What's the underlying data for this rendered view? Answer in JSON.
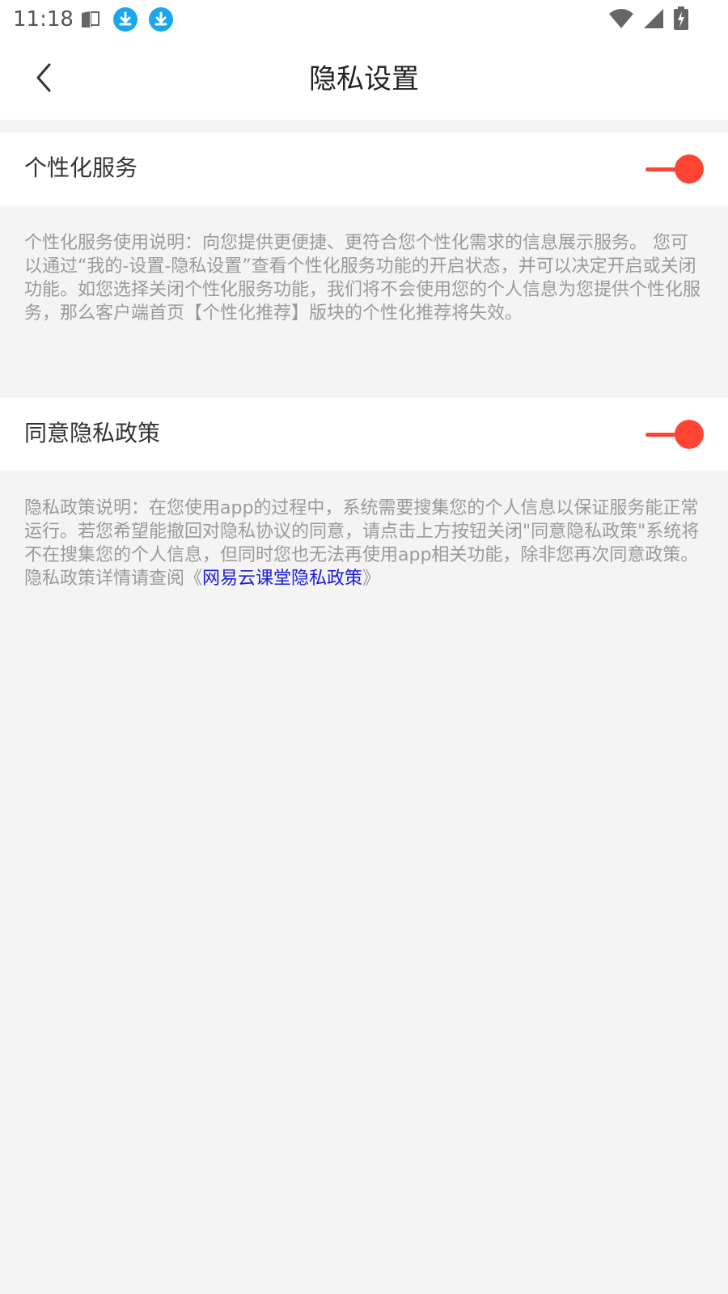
{
  "status_bar": {
    "time": "11:18",
    "left_icons": [
      "notification-icon",
      "download-icon",
      "download-icon"
    ],
    "right_icons": [
      "wifi-icon",
      "signal-icon",
      "battery-charging-icon"
    ],
    "accent": "#1aa7f0"
  },
  "header": {
    "title": "隐私设置",
    "back_icon": "chevron-left-icon"
  },
  "settings": [
    {
      "label": "个性化服务",
      "enabled": true,
      "description": "个性化服务使用说明：向您提供更便捷、更符合您个性化需求的信息展示服务。 您可以通过“我的-设置-隐私设置”查看个性化服务功能的开启状态，并可以决定开启或关闭功能。如您选择关闭个性化服务功能，我们将不会使用您的个人信息为您提供个性化服务，那么客户端首页【个性化推荐】版块的个性化推荐将失效。"
    },
    {
      "label": "同意隐私政策",
      "enabled": true,
      "description": "隐私政策说明：在您使用app的过程中，系统需要搜集您的个人信息以保证服务能正常运行。若您希望能撤回对隐私协议的同意，请点击上方按钮关闭\"同意隐私政策\"系统将不在搜集您的个人信息，但同时您也无法再使用app相关功能，除非您再次同意政策。",
      "link_prefix": "隐私政策详情请查阅《",
      "link_text": "网易云课堂隐私政策",
      "link_suffix": "》"
    }
  ],
  "colors": {
    "toggle_on": "#ff4433",
    "link": "#1a1adc",
    "background": "#f4f4f4"
  }
}
